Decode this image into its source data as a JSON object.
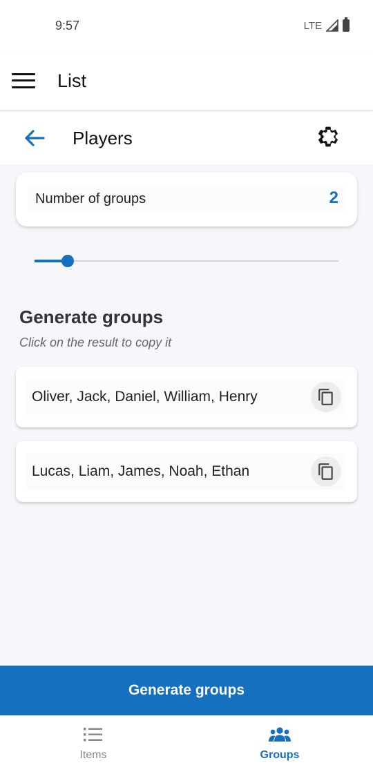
{
  "status_bar": {
    "time": "9:57",
    "network": "LTE"
  },
  "app_bar": {
    "title": "List",
    "menu_icon": "hamburger-menu-icon"
  },
  "sub_bar": {
    "title": "Players",
    "back_icon": "arrow-back-icon",
    "settings_icon": "gear-icon"
  },
  "groups_setting": {
    "label": "Number of groups",
    "value": "2",
    "slider_fraction": 0.11
  },
  "section": {
    "title": "Generate groups",
    "subtitle": "Click on the result to copy it"
  },
  "results": [
    {
      "text": "Oliver, Jack, Daniel, William, Henry",
      "copy_icon": "copy-icon"
    },
    {
      "text": "Lucas, Liam, James, Noah, Ethan",
      "copy_icon": "copy-icon"
    }
  ],
  "generate_button": {
    "label": "Generate groups"
  },
  "bottom_nav": {
    "items": [
      {
        "label": "Items",
        "icon": "list-icon",
        "active": false
      },
      {
        "label": "Groups",
        "icon": "group-icon",
        "active": true
      }
    ]
  },
  "colors": {
    "accent": "#1570c0",
    "background": "#f5f7fa",
    "inactive": "#888888"
  }
}
